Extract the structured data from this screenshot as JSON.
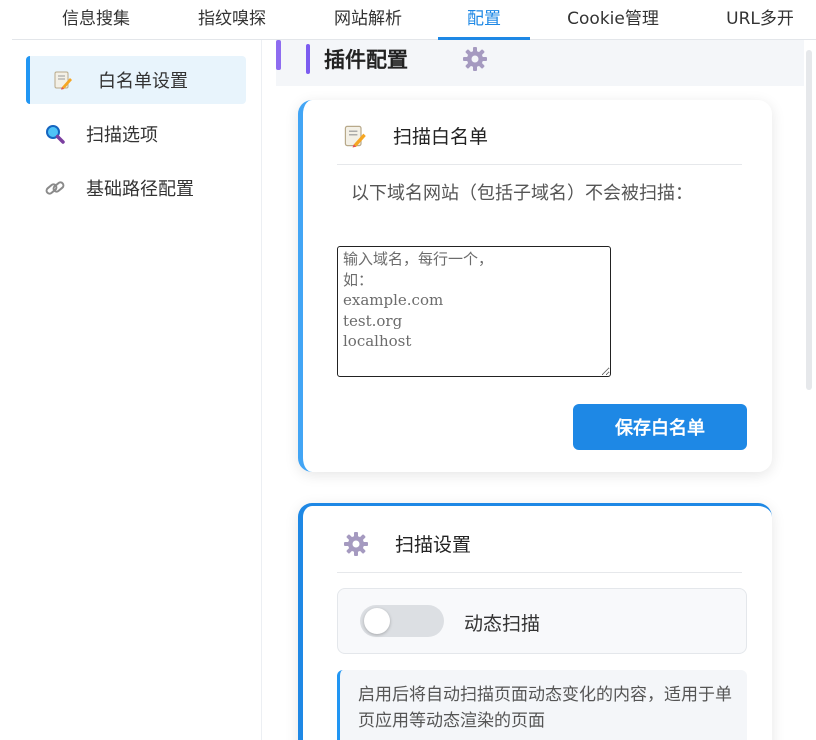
{
  "topnav": {
    "tabs": [
      {
        "label": "信息搜集",
        "active": false
      },
      {
        "label": "指纹嗅探",
        "active": false
      },
      {
        "label": "网站解析",
        "active": false
      },
      {
        "label": "配置",
        "active": true
      },
      {
        "label": "Cookie管理",
        "active": false
      },
      {
        "label": "URL多开",
        "active": false
      }
    ]
  },
  "sidebar": {
    "items": [
      {
        "label": "白名单设置",
        "icon": "memo-pencil-icon",
        "active": true
      },
      {
        "label": "扫描选项",
        "icon": "magnifier-icon",
        "active": false
      },
      {
        "label": "基础路径配置",
        "icon": "link-icon",
        "active": false
      }
    ]
  },
  "main": {
    "title": "插件配置",
    "title_icon": "gear-icon"
  },
  "whitelist_card": {
    "title": "扫描白名单",
    "icon": "memo-pencil-icon",
    "description": "以下域名网站（包括子域名）不会被扫描：",
    "textarea_placeholder": "输入域名，每行一个，\n如：\nexample.com\ntest.org\nlocalhost",
    "textarea_value": "",
    "save_label": "保存白名单"
  },
  "scan_card": {
    "title": "扫描设置",
    "icon": "gear-icon",
    "dynamic_scan_label": "动态扫描",
    "dynamic_scan_enabled": false,
    "info_text": "启用后将自动扫描页面动态变化的内容，适用于单页应用等动态渲染的页面"
  },
  "colors": {
    "accent": "#1e88e5",
    "header_bar": "#8e6cf0",
    "sidebar_active_bg": "#e8f4fc"
  }
}
